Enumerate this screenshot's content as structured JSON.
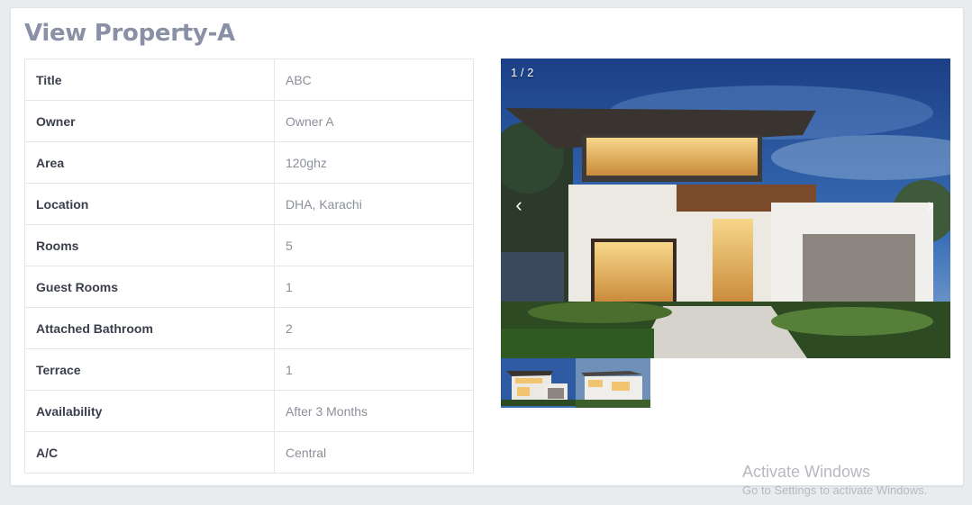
{
  "page": {
    "title": "View Property-A"
  },
  "details": [
    {
      "label": "Title",
      "value": "ABC"
    },
    {
      "label": "Owner",
      "value": "Owner A"
    },
    {
      "label": "Area",
      "value": "120ghz"
    },
    {
      "label": "Location",
      "value": "DHA, Karachi"
    },
    {
      "label": "Rooms",
      "value": "5"
    },
    {
      "label": "Guest Rooms",
      "value": "1"
    },
    {
      "label": "Attached Bathroom",
      "value": "2"
    },
    {
      "label": "Terrace",
      "value": "1"
    },
    {
      "label": "Availability",
      "value": "After 3 Months"
    },
    {
      "label": "A/C",
      "value": "Central"
    }
  ],
  "gallery": {
    "counter": "1 / 2",
    "prev_icon": "‹",
    "next_icon": "›"
  },
  "watermark": {
    "line1": "Activate Windows",
    "line2": "Go to Settings to activate Windows."
  }
}
